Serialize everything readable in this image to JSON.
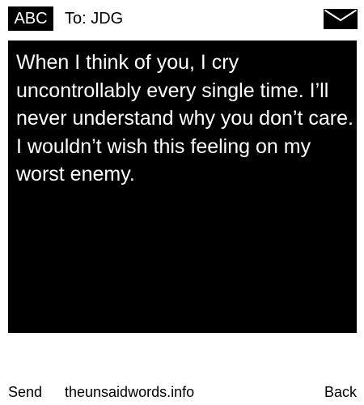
{
  "header": {
    "mode_badge": "ABC",
    "recipient": "To: JDG",
    "envelope_icon": "envelope-icon"
  },
  "message": {
    "body": "When I think of you, I cry uncontrollably every single time. I’ll never understand why you don’t care. I wouldn’t wish this feeling on my worst enemy."
  },
  "footer": {
    "send_label": "Send",
    "site_label": "theunsaidwords.info",
    "back_label": "Back"
  },
  "colors": {
    "background": "#ffffff",
    "message_background": "#000000",
    "message_text": "#ffffff"
  }
}
